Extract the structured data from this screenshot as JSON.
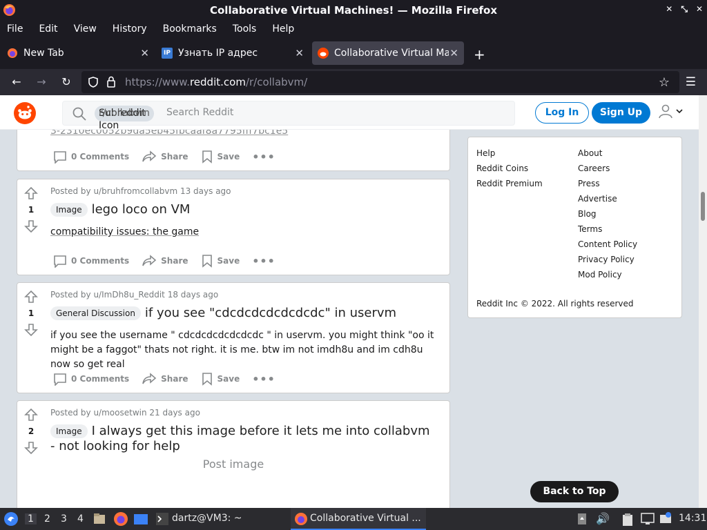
{
  "window": {
    "title": "Collaborative Virtual Machines! — Mozilla Firefox"
  },
  "menubar": [
    "File",
    "Edit",
    "View",
    "History",
    "Bookmarks",
    "Tools",
    "Help"
  ],
  "tabs": [
    {
      "label": "New Tab"
    },
    {
      "label": "Узнать IP адрес"
    },
    {
      "label": "Collaborative Virtual Mac"
    }
  ],
  "urlbar": {
    "prefix": "https://www.",
    "domain": "reddit.com",
    "path": "/r/collabvm/"
  },
  "reddit_header": {
    "search_pill": "r/collabvm",
    "search_pill_overlap": "Subreddit",
    "search_pill_icon_label": "Icon",
    "search_placeholder": "Search Reddit",
    "login": "Log In",
    "signup": "Sign Up"
  },
  "posts": [
    {
      "partial_link": "3-2310ec0052b9da5eb45fbcaaf8a7795fff7bc1e5",
      "comments": "0 Comments",
      "share": "Share",
      "save": "Save"
    },
    {
      "votes": "1",
      "meta": "Posted by u/bruhfromcollabvm 13 days ago",
      "flair": "Image",
      "title": "lego loco on VM",
      "link": "compatibility issues: the game",
      "comments": "0 Comments",
      "share": "Share",
      "save": "Save"
    },
    {
      "votes": "1",
      "meta": "Posted by u/ImDh8u_Reddit 18 days ago",
      "flair": "General Discussion",
      "title": "if you see \"cdcdcdcdcdcdcdc\" in uservm",
      "body": "if you see the username \" cdcdcdcdcdcdcdc \" in uservm. you might think \"oo it might be a faggot\" thats not right. it is me. btw im not imdh8u and im cdh8u now so get real",
      "comments": "0 Comments",
      "share": "Share",
      "save": "Save"
    },
    {
      "votes": "2",
      "meta": "Posted by u/moosetwin 21 days ago",
      "flair": "Image",
      "title": "I always get this image before it lets me into collabvm - not looking for help",
      "image_alt": "Post image"
    }
  ],
  "sidebar": {
    "col1": [
      "Help",
      "Reddit Coins",
      "Reddit Premium"
    ],
    "col2": [
      "About",
      "Careers",
      "Press",
      "Advertise",
      "Blog",
      "Terms",
      "Content Policy",
      "Privacy Policy",
      "Mod Policy"
    ],
    "copyright": "Reddit Inc © 2022. All rights reserved"
  },
  "back_to_top": "Back to Top",
  "taskbar": {
    "workspaces": [
      "1",
      "2",
      "3",
      "4"
    ],
    "terminal": "dartz@VM3: ~",
    "firefox_task": "Collaborative Virtual ...",
    "clock": "14:31"
  },
  "colors": {
    "reddit_orange": "#ff4500",
    "reddit_blue": "#0079d3",
    "firefox_dark": "#1c1b22"
  }
}
